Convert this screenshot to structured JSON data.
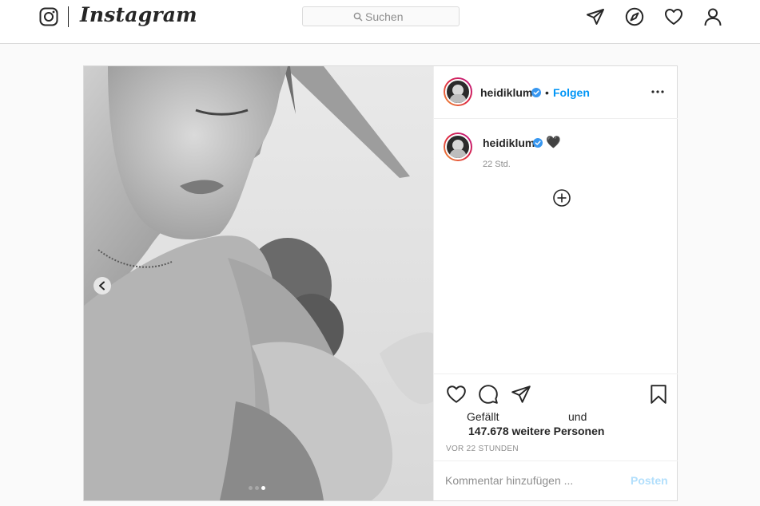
{
  "header": {
    "brand": "Instagram",
    "search": {
      "placeholder": "Suchen"
    },
    "icons": [
      "instagram-glyph-icon",
      "search-icon",
      "direct-paper-plane-icon",
      "explore-compass-icon",
      "activity-heart-icon",
      "profile-person-icon"
    ]
  },
  "post": {
    "username": "heidiklum",
    "verified": true,
    "follow_label": "Folgen",
    "separator": "•",
    "caption_text": "🖤",
    "caption_time": "22 Std.",
    "likes_line1_prefix": "Gefällt",
    "likes_line1_suffix": "und",
    "likes_line2": "147.678 weitere Personen",
    "time_ago": "VOR 22 STUNDEN",
    "comment_placeholder": "Kommentar hinzufügen ...",
    "post_button": "Posten",
    "carousel": {
      "count": 3,
      "active_index": 3
    }
  },
  "colors": {
    "accent": "#0095f6",
    "post_button_disabled": "#b2dffc",
    "text": "#262626",
    "muted": "#8e8e8e",
    "border": "#dbdbdb",
    "verified": "#3897f0"
  }
}
